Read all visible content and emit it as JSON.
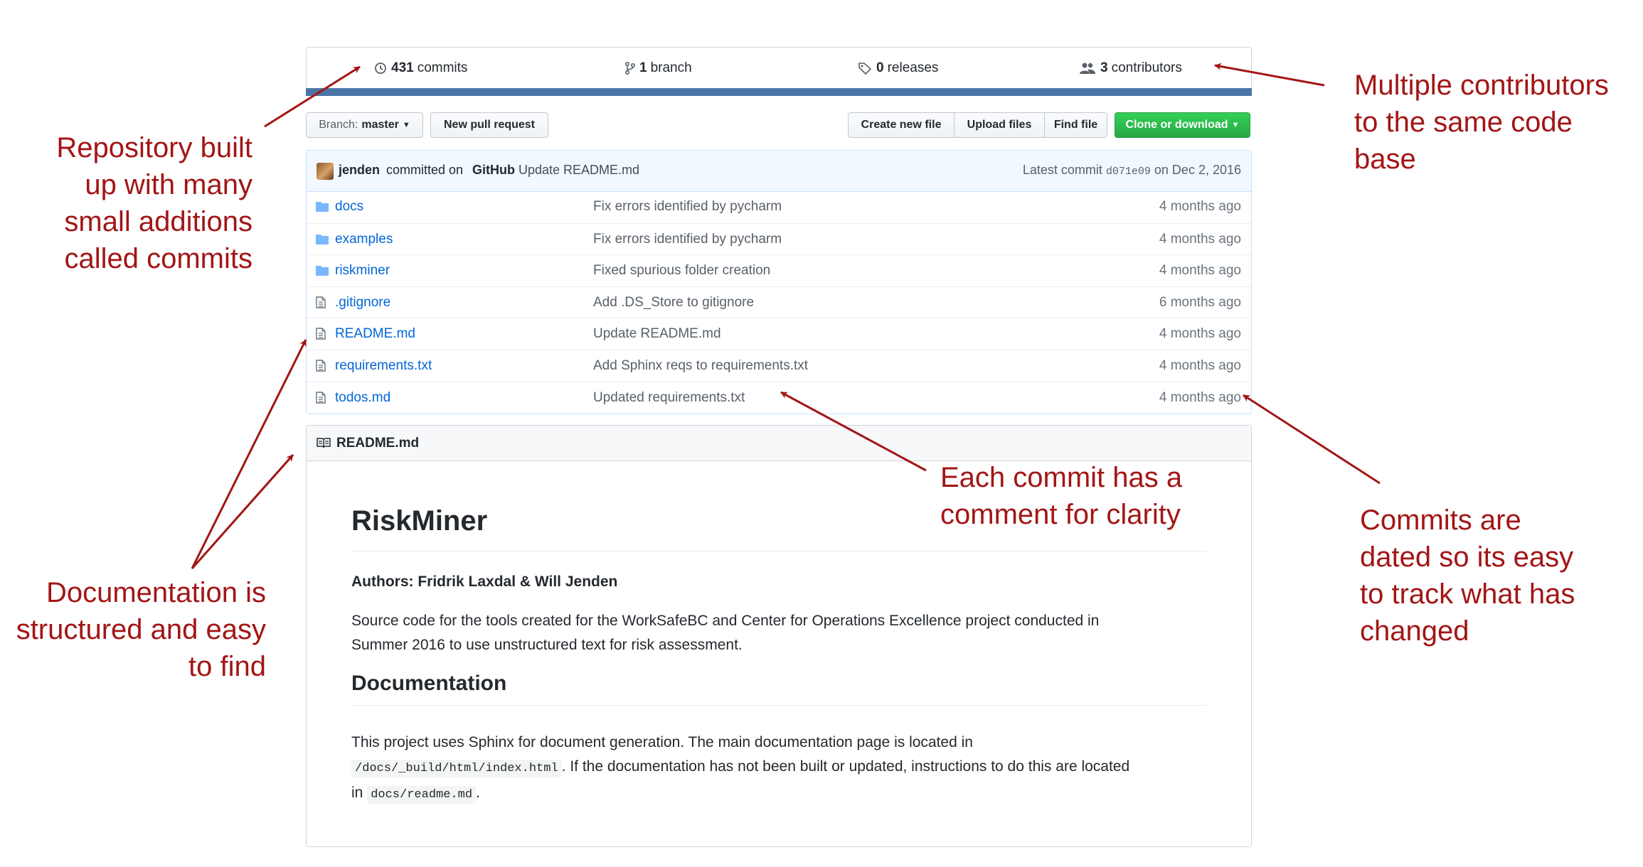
{
  "repo_stats": {
    "commits_count": "431",
    "commits_label": "commits",
    "branch_count": "1",
    "branch_label": "branch",
    "releases_count": "0",
    "releases_label": "releases",
    "contributors_count": "3",
    "contributors_label": "contributors",
    "bar_color": "#4a74a8"
  },
  "toolbar": {
    "branch_prefix": "Branch:",
    "branch_value": "master",
    "new_pull_request": "New pull request",
    "create_new_file": "Create new file",
    "upload_files": "Upload files",
    "find_file": "Find file",
    "clone_or_download": "Clone or download"
  },
  "latest_commit": {
    "author": "jenden",
    "committed_on": "committed on",
    "platform": "GitHub",
    "message": "Update README.md",
    "prefix": "Latest commit",
    "sha": "d071e09",
    "date": "on Dec 2, 2016"
  },
  "files": [
    {
      "icon": "folder-icon",
      "name": "docs",
      "message": "Fix errors identified by pycharm",
      "age": "4 months ago"
    },
    {
      "icon": "folder-icon",
      "name": "examples",
      "message": "Fix errors identified by pycharm",
      "age": "4 months ago"
    },
    {
      "icon": "folder-icon",
      "name": "riskminer",
      "message": "Fixed spurious folder creation",
      "age": "4 months ago"
    },
    {
      "icon": "file-icon",
      "name": ".gitignore",
      "message": "Add .DS_Store to gitignore",
      "age": "6 months ago"
    },
    {
      "icon": "file-icon",
      "name": "README.md",
      "message": "Update README.md",
      "age": "4 months ago"
    },
    {
      "icon": "file-icon",
      "name": "requirements.txt",
      "message": "Add Sphinx reqs to requirements.txt",
      "age": "4 months ago"
    },
    {
      "icon": "file-icon",
      "name": "todos.md",
      "message": "Updated requirements.txt",
      "age": "4 months ago"
    }
  ],
  "readme": {
    "header": "README.md",
    "title": "RiskMiner",
    "authors": "Authors: Fridrik Laxdal & Will Jenden",
    "intro_line1": "Source code for the tools created for the WorkSafeBC and Center for Operations Excellence project conducted in",
    "intro_line2": "Summer 2016 to use unstructured text for risk assessment.",
    "doc_heading": "Documentation",
    "doc_line1": "This project uses Sphinx for document generation. The main documentation page is located in",
    "doc_code1": "/docs/_build/html/index.html",
    "doc_line2": ". If the documentation has not been built or updated, instructions to do this are located",
    "doc_in": "in",
    "doc_code2": "docs/readme.md",
    "doc_end": "."
  },
  "annotations": {
    "color": "#a31515",
    "commits": [
      "Repository built",
      "up with many",
      "small additions",
      "called commits"
    ],
    "contributors": [
      "Multiple contributors",
      "to the same code",
      "base"
    ],
    "comment": [
      "Each commit has a",
      "comment for clarity"
    ],
    "dated": [
      "Commits are",
      "dated so its easy",
      "to track what has",
      "changed"
    ],
    "docs": [
      "Documentation is",
      "structured and easy",
      "to find"
    ]
  }
}
